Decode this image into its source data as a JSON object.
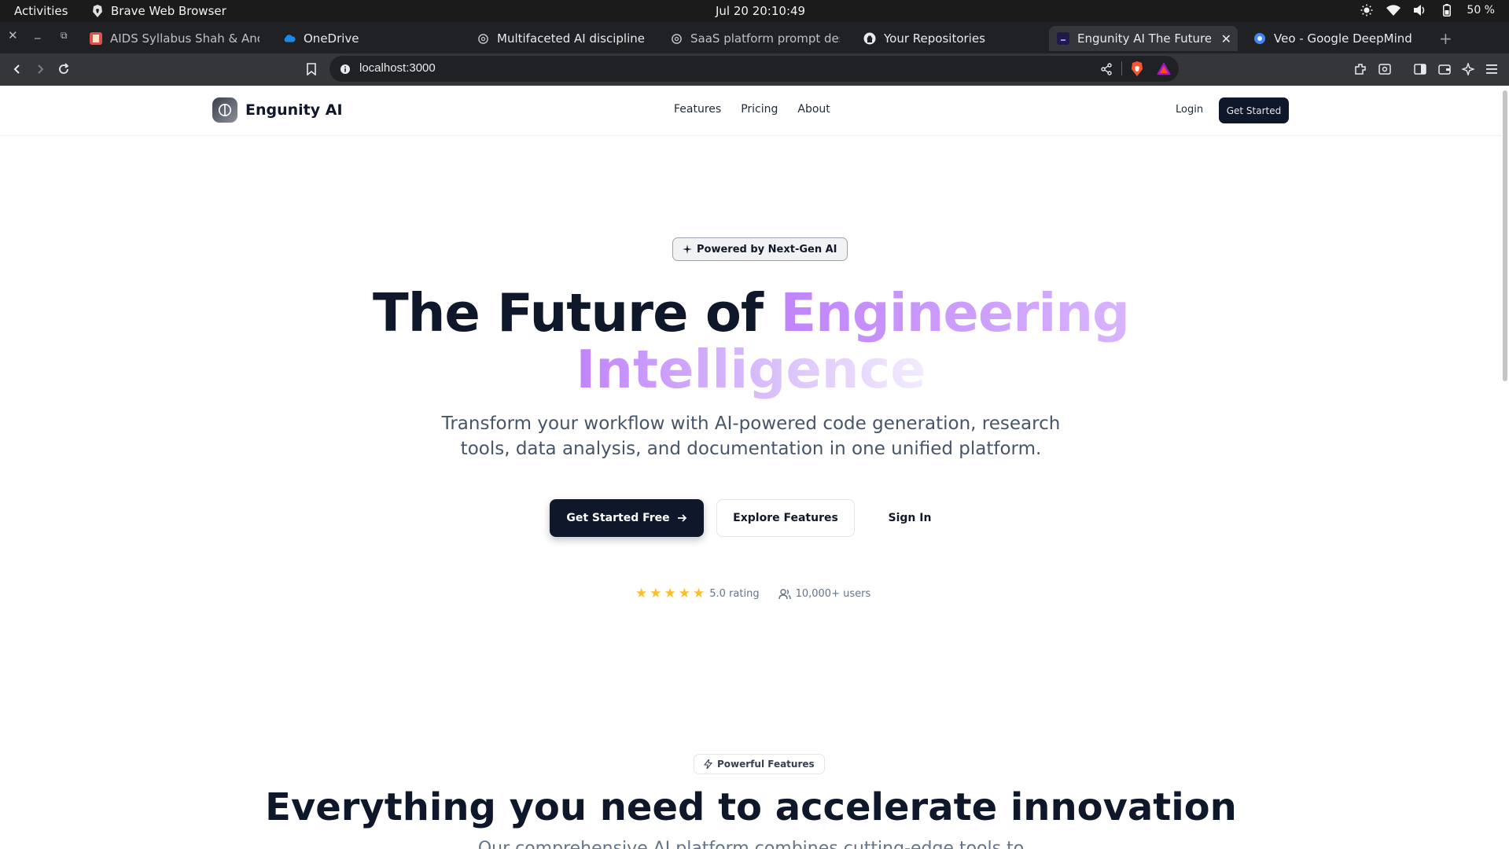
{
  "system_bar": {
    "activities": "Activities",
    "app_name": "Brave Web Browser",
    "clock": "Jul 20  20:10:49",
    "battery": "50 %"
  },
  "browser": {
    "tabs": [
      {
        "label": "AIDS Syllabus Shah & Anchor",
        "icon": "document-favicon-icon"
      },
      {
        "label": "OneDrive",
        "icon": "onedrive-cloud-icon"
      },
      {
        "label": "Multifaceted AI discipline",
        "icon": "openai-icon"
      },
      {
        "label": "SaaS platform prompt design",
        "icon": "openai-icon"
      },
      {
        "label": "Your Repositories",
        "icon": "github-icon"
      },
      {
        "label": "Engunity AI The Future of",
        "icon": "engunity-favicon-icon",
        "active": true
      },
      {
        "label": "Veo - Google DeepMind",
        "icon": "deepmind-icon"
      }
    ],
    "url": "localhost:3000"
  },
  "site": {
    "brand": "Engunity AI",
    "nav": {
      "links": [
        "Features",
        "Pricing",
        "About"
      ],
      "login": "Login",
      "cta": "Get Started"
    },
    "hero": {
      "badge": "Powered by Next-Gen AI",
      "title_prefix": "The Future of ",
      "title_accent_1": "Engineering",
      "title_accent_2": "Intelligence",
      "subtitle": "Transform your workflow with AI-powered code generation, research tools, data analysis, and documentation in one unified platform.",
      "primary_button": "Get Started Free",
      "secondary_button": "Explore Features",
      "tertiary_button": "Sign In",
      "rating_stars": 5,
      "rating_text": "5.0 rating",
      "users_text": "10,000+ users"
    },
    "features": {
      "badge": "Powerful Features",
      "title": "Everything you need to accelerate innovation",
      "subtitle_partial": "Our comprehensive AI platform combines cutting-edge tools to"
    }
  },
  "colors": {
    "primary": "#0f172a",
    "accent_gradient_start": "#c084fc",
    "star": "#fbbf24"
  }
}
